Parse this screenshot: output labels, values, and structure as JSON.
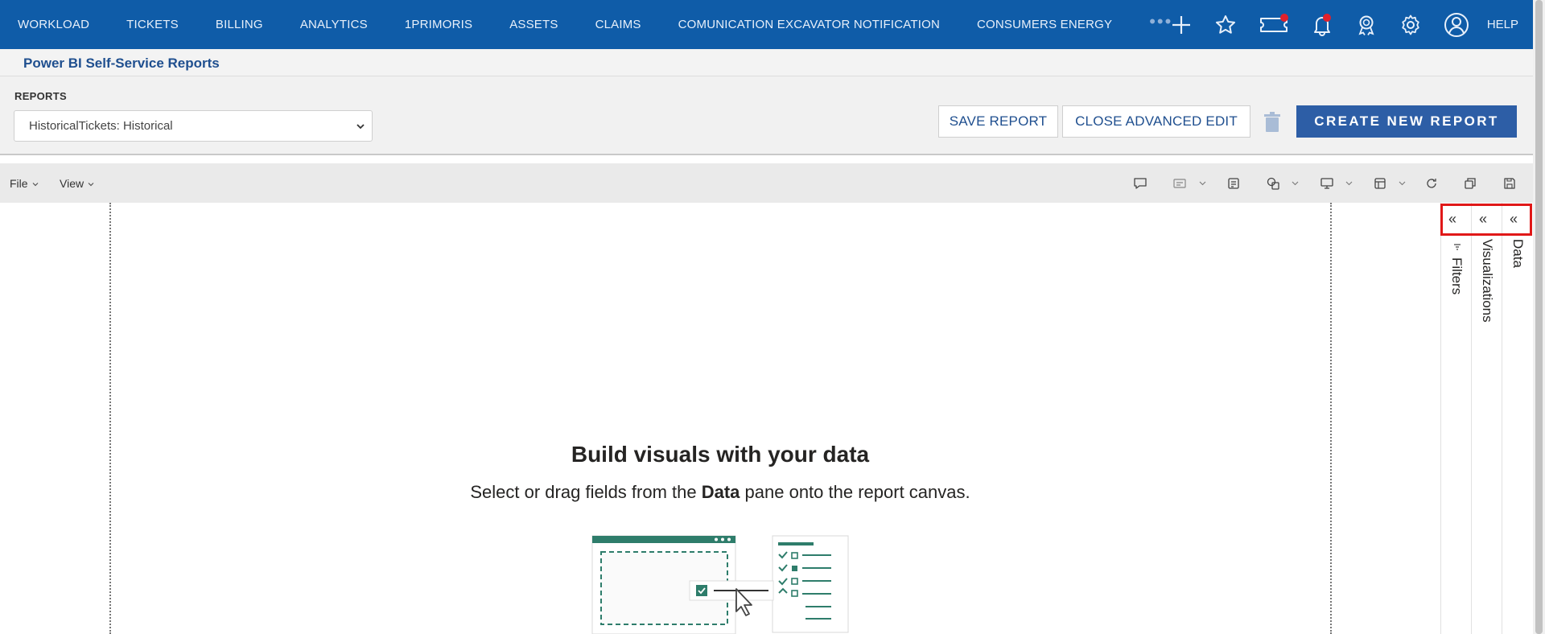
{
  "topnav": {
    "items": [
      "WORKLOAD",
      "TICKETS",
      "BILLING",
      "ANALYTICS",
      "1PRIMORIS",
      "ASSETS",
      "CLAIMS",
      "COMUNICATION EXCAVATOR NOTIFICATION",
      "CONSUMERS ENERGY"
    ],
    "more": "•••",
    "help": "HELP",
    "icons": [
      "plus-icon",
      "star-icon",
      "ticket-icon",
      "bell-icon",
      "award-icon",
      "gear-icon",
      "user-icon"
    ]
  },
  "page": {
    "title": "Power BI Self-Service Reports"
  },
  "reports": {
    "label": "REPORTS",
    "selected": "HistoricalTickets: Historical",
    "save_label": "SAVE REPORT",
    "close_label": "CLOSE ADVANCED EDIT",
    "create_label": "CREATE NEW REPORT"
  },
  "pbi_toolbar": {
    "file": "File",
    "view": "View"
  },
  "canvas": {
    "empty_title": "Build visuals with your data",
    "empty_sub_pre": "Select or drag fields from the ",
    "empty_sub_bold": "Data",
    "empty_sub_post": " pane onto the report canvas."
  },
  "panes": {
    "filters": "Filters",
    "visualizations": "Visualizations",
    "data": "Data",
    "expand_glyph": "«"
  },
  "colors": {
    "nav": "#0f5ca8",
    "primary_button": "#2d5ea6",
    "highlight": "#e01818",
    "illustration": "#2e7d6b"
  }
}
